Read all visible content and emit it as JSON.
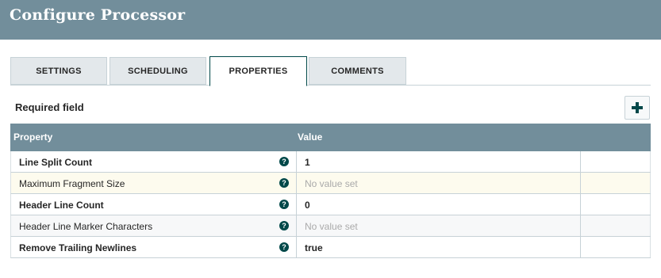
{
  "header": {
    "title": "Configure Processor"
  },
  "tabs": [
    {
      "label": "SETTINGS"
    },
    {
      "label": "SCHEDULING"
    },
    {
      "label": "PROPERTIES",
      "active": true
    },
    {
      "label": "COMMENTS"
    }
  ],
  "required_field_label": "Required field",
  "add_property_icon": "plus-icon",
  "grid": {
    "columns": {
      "property": "Property",
      "value": "Value"
    },
    "help_icon": "question-circle-icon",
    "help_glyph": "?",
    "rows": [
      {
        "name": "Line Split Count",
        "value": "1",
        "required": true
      },
      {
        "name": "Maximum Fragment Size",
        "value": "No value set",
        "required": false
      },
      {
        "name": "Header Line Count",
        "value": "0",
        "required": true
      },
      {
        "name": "Header Line Marker Characters",
        "value": "No value set",
        "required": false
      },
      {
        "name": "Remove Trailing Newlines",
        "value": "true",
        "required": true
      }
    ]
  },
  "colors": {
    "header_bg": "#728e9b",
    "accent": "#004849",
    "highlight_row": "#fdfbee",
    "unset_text": "#aaaaaa"
  }
}
